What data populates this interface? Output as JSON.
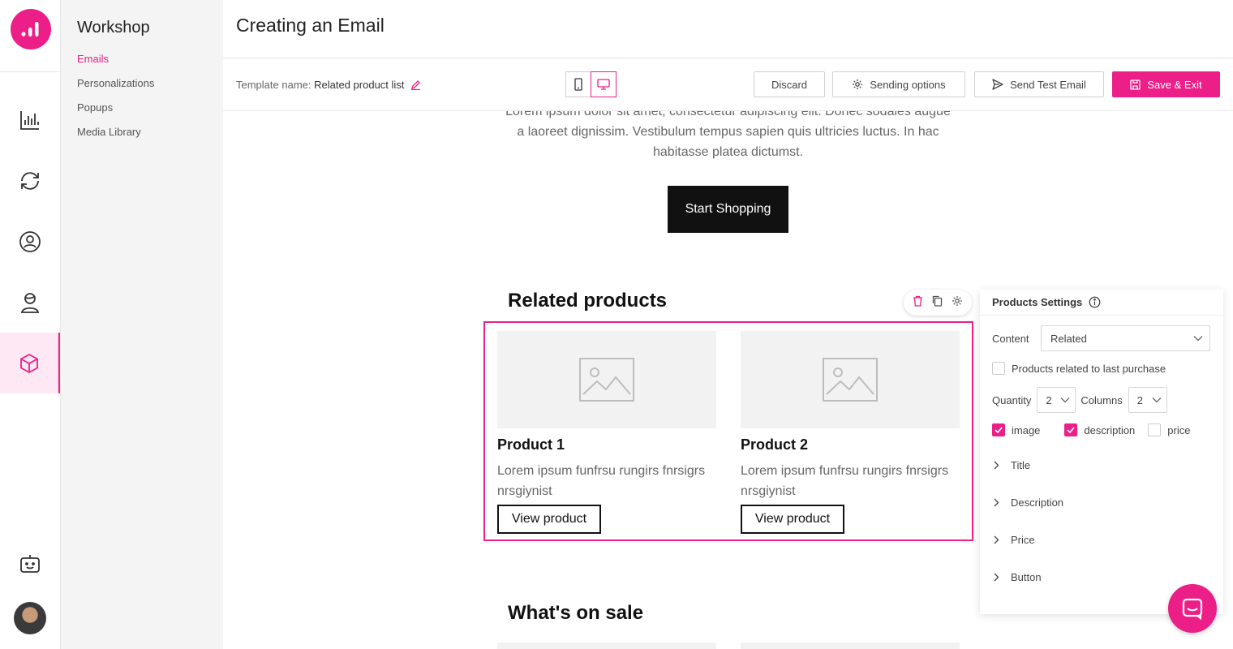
{
  "sidebar": {
    "title": "Workshop",
    "items": [
      {
        "label": "Emails",
        "active": true
      },
      {
        "label": "Personalizations"
      },
      {
        "label": "Popups"
      },
      {
        "label": "Media Library"
      }
    ]
  },
  "rail": {
    "icons": [
      "logo-icon",
      "analytics-icon",
      "automation-icon",
      "contacts-icon",
      "profile-icon",
      "products-icon",
      "chatbot-icon",
      "avatar"
    ],
    "active": "products-icon"
  },
  "header": {
    "title": "Creating an Email"
  },
  "toolbar": {
    "template_label": "Template name:",
    "template_name": "Related product list",
    "device_modes": [
      "mobile",
      "desktop"
    ],
    "active_device": "desktop",
    "discard": "Discard",
    "sending_options": "Sending options",
    "send_test": "Send Test Email",
    "save_exit": "Save & Exit"
  },
  "email": {
    "intro": "Lorem ipsum dolor sit amet, consectetur adipiscing elit. Donec sodales augue a laoreet dignissim. Vestibulum tempus sapien quis ultricies luctus. In hac habitasse platea dictumst.",
    "cta": "Start Shopping",
    "related_title": "Related products",
    "products": [
      {
        "title": "Product 1",
        "desc": "Lorem ipsum funfrsu rungirs fnrsigrs nrsgiynist",
        "button": "View product"
      },
      {
        "title": "Product 2",
        "desc": "Lorem ipsum funfrsu rungirs fnrsigrs nrsgiynist",
        "button": "View product"
      }
    ],
    "sale_title": "What's on sale"
  },
  "settings": {
    "title": "Products Settings",
    "content_label": "Content",
    "content_value": "Related",
    "related_checkbox": "Products related to last purchase",
    "quantity_label": "Quantity",
    "quantity_value": "2",
    "columns_label": "Columns",
    "columns_value": "2",
    "show": {
      "image": {
        "label": "image",
        "checked": true
      },
      "description": {
        "label": "description",
        "checked": true
      },
      "price": {
        "label": "price",
        "checked": false
      }
    },
    "sections": [
      "Title",
      "Description",
      "Price",
      "Button"
    ]
  },
  "colors": {
    "accent": "#ec1e87"
  }
}
